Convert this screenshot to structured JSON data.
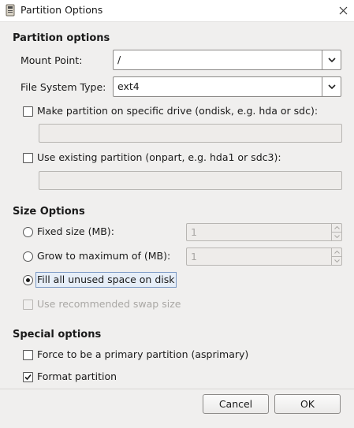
{
  "window": {
    "title": "Partition Options",
    "close_icon": "close-icon",
    "app_icon": "partition-app-icon"
  },
  "partition_options": {
    "heading": "Partition options",
    "mount_point_label": "Mount Point:",
    "mount_point_value": "/",
    "fs_type_label": "File System Type:",
    "fs_type_value": "ext4",
    "ondisk_label": "Make partition on specific drive (ondisk, e.g. hda or sdc):",
    "ondisk_checked": false,
    "ondisk_value": "",
    "onpart_label": "Use existing partition (onpart, e.g. hda1 or sdc3):",
    "onpart_checked": false,
    "onpart_value": ""
  },
  "size_options": {
    "heading": "Size Options",
    "fixed_size_label": "Fixed size (MB):",
    "fixed_size_value": "1",
    "grow_label": "Grow to maximum of (MB):",
    "grow_value": "1",
    "fill_label": "Fill all unused space on disk",
    "selected": "fill",
    "swap_label": "Use recommended swap size",
    "swap_checked": false
  },
  "special_options": {
    "heading": "Special options",
    "primary_label": "Force to be a primary partition (asprimary)",
    "primary_checked": false,
    "format_label": "Format partition",
    "format_checked": true
  },
  "buttons": {
    "cancel": "Cancel",
    "ok": "OK"
  }
}
